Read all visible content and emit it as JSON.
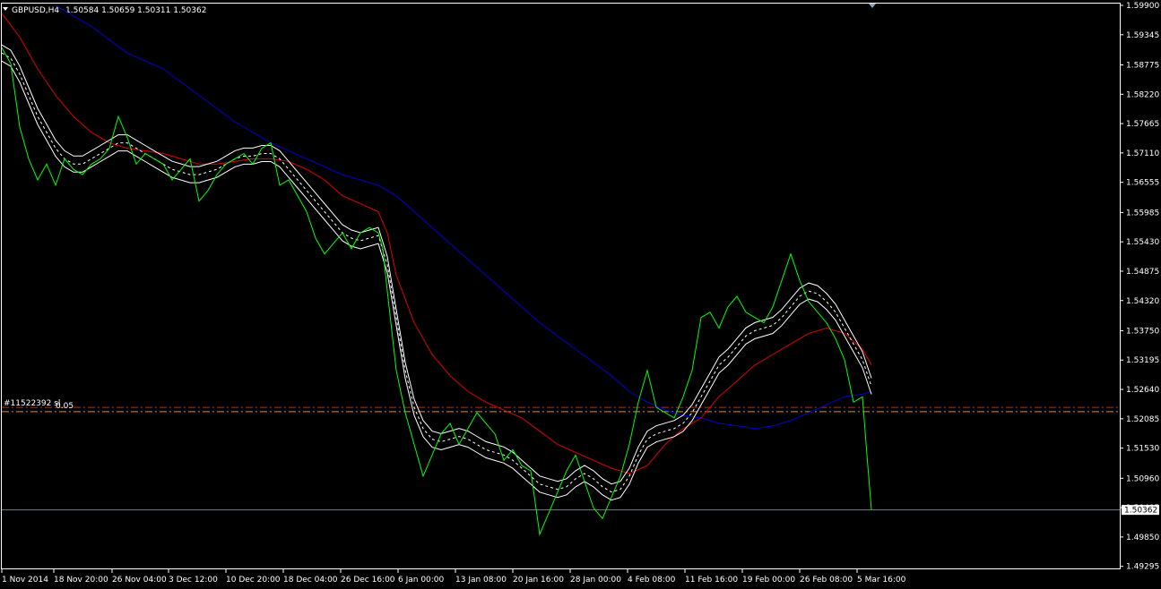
{
  "header": {
    "symbol": "GBPUSD,H4",
    "quote": "1.50584 1.50659 1.50311 1.50362"
  },
  "order": {
    "label": "#11522392 sl",
    "lots": "0.05"
  },
  "colors": {
    "background": "#000000",
    "price": "#00ff00",
    "ma_fast": "#e00000",
    "ma_slow": "#0000d0",
    "bands": "#ffffff",
    "current_price_line": "#6f7f9f"
  },
  "chart_data": {
    "type": "line",
    "ylim": [
      1.4929,
      1.599
    ],
    "y_ticks": [
      "1.59900",
      "1.59345",
      "1.58775",
      "1.58220",
      "1.57665",
      "1.57110",
      "1.56555",
      "1.55985",
      "1.55430",
      "1.54875",
      "1.54320",
      "1.53750",
      "1.53195",
      "1.52640",
      "1.52085",
      "1.51530",
      "1.50960",
      "1.50405",
      "1.49850",
      "1.49295"
    ],
    "x_ticks": [
      "1 Nov 2014",
      "18 Nov 20:00",
      "26 Nov 04:00",
      "3 Dec 12:00",
      "10 Dec 20:00",
      "18 Dec 04:00",
      "26 Dec 16:00",
      "6 Jan 00:00",
      "13 Jan 08:00",
      "20 Jan 16:00",
      "28 Jan 00:00",
      "4 Feb 08:00",
      "11 Feb 16:00",
      "19 Feb 00:00",
      "26 Feb 08:00",
      "5 Mar 16:00"
    ],
    "current_price": "1.50362",
    "order_level": 1.523,
    "sl_level": 1.5222,
    "series": [
      {
        "key": "price",
        "x": [
          0,
          10,
          20,
          30,
          40,
          50,
          60,
          70,
          80,
          90,
          100,
          110,
          120,
          130,
          140,
          150,
          160,
          170,
          180,
          190,
          200,
          210,
          220,
          230,
          240,
          250,
          260,
          270,
          280,
          290,
          300,
          310,
          320,
          330,
          340,
          350,
          360,
          370,
          380,
          390,
          400,
          410,
          420,
          425,
          430,
          440,
          450,
          460,
          470,
          480,
          490,
          500,
          510,
          520,
          530,
          540,
          550,
          560,
          570,
          580,
          590,
          600,
          610,
          620,
          630,
          640,
          650,
          660,
          670,
          680,
          690,
          700,
          710,
          720,
          730,
          740,
          750,
          760,
          770,
          780,
          790,
          800,
          810,
          820,
          830,
          840,
          850,
          860,
          870,
          880,
          890,
          900,
          910,
          920,
          930,
          940,
          950,
          960,
          965,
          970
        ],
        "y": [
          1.591,
          1.588,
          1.576,
          1.57,
          1.566,
          1.569,
          1.565,
          1.57,
          1.568,
          1.567,
          1.569,
          1.57,
          1.572,
          1.578,
          1.574,
          1.569,
          1.571,
          1.57,
          1.569,
          1.566,
          1.568,
          1.57,
          1.562,
          1.564,
          1.567,
          1.569,
          1.57,
          1.571,
          1.569,
          1.572,
          1.573,
          1.565,
          1.566,
          1.563,
          1.56,
          1.555,
          1.552,
          1.554,
          1.556,
          1.553,
          1.556,
          1.557,
          1.556,
          1.553,
          1.545,
          1.53,
          1.522,
          1.516,
          1.51,
          1.514,
          1.518,
          1.52,
          1.516,
          1.519,
          1.522,
          1.52,
          1.518,
          1.513,
          1.515,
          1.512,
          1.511,
          1.499,
          1.503,
          1.507,
          1.511,
          1.514,
          1.509,
          1.504,
          1.502,
          1.506,
          1.51,
          1.516,
          1.524,
          1.53,
          1.523,
          1.522,
          1.521,
          1.525,
          1.53,
          1.54,
          1.541,
          1.538,
          1.542,
          1.544,
          1.541,
          1.54,
          1.539,
          1.542,
          1.547,
          1.552,
          1.547,
          1.543,
          1.541,
          1.539,
          1.536,
          1.532,
          1.524,
          1.525,
          1.514,
          1.50362
        ]
      },
      {
        "key": "ma_fast",
        "x": [
          0,
          20,
          40,
          60,
          80,
          100,
          120,
          140,
          160,
          180,
          200,
          220,
          240,
          260,
          280,
          300,
          320,
          340,
          360,
          380,
          400,
          420,
          430,
          440,
          460,
          480,
          500,
          520,
          540,
          560,
          580,
          600,
          620,
          640,
          660,
          680,
          700,
          720,
          740,
          760,
          780,
          800,
          820,
          840,
          860,
          880,
          900,
          920,
          940,
          960,
          970
        ],
        "y": [
          1.5975,
          1.593,
          1.587,
          1.582,
          1.578,
          1.575,
          1.573,
          1.572,
          1.5715,
          1.571,
          1.57,
          1.569,
          1.569,
          1.5695,
          1.57,
          1.57,
          1.5695,
          1.568,
          1.566,
          1.563,
          1.5615,
          1.56,
          1.556,
          1.548,
          1.539,
          1.533,
          1.529,
          1.526,
          1.524,
          1.5225,
          1.521,
          1.5185,
          1.516,
          1.5145,
          1.513,
          1.5115,
          1.5105,
          1.512,
          1.516,
          1.519,
          1.521,
          1.525,
          1.528,
          1.531,
          1.533,
          1.535,
          1.537,
          1.538,
          1.537,
          1.534,
          1.531
        ]
      },
      {
        "key": "ma_slow",
        "x": [
          60,
          100,
          140,
          180,
          220,
          260,
          300,
          340,
          380,
          420,
          440,
          480,
          520,
          560,
          600,
          640,
          680,
          700,
          720,
          740,
          760,
          780,
          800,
          820,
          840,
          860,
          880,
          900,
          920,
          940,
          960,
          970
        ],
        "y": [
          1.599,
          1.595,
          1.59,
          1.587,
          1.582,
          1.577,
          1.573,
          1.57,
          1.567,
          1.565,
          1.563,
          1.557,
          1.551,
          1.545,
          1.539,
          1.534,
          1.529,
          1.526,
          1.524,
          1.5225,
          1.5215,
          1.521,
          1.52,
          1.5195,
          1.519,
          1.5195,
          1.5205,
          1.522,
          1.5235,
          1.525,
          1.5255,
          1.526
        ]
      },
      {
        "key": "bands",
        "x": [
          0,
          10,
          20,
          30,
          40,
          50,
          60,
          70,
          80,
          90,
          100,
          110,
          120,
          130,
          140,
          150,
          160,
          170,
          180,
          190,
          200,
          210,
          220,
          230,
          240,
          250,
          260,
          270,
          280,
          290,
          300,
          310,
          320,
          330,
          340,
          350,
          360,
          370,
          380,
          390,
          400,
          410,
          420,
          430,
          440,
          450,
          460,
          470,
          480,
          490,
          500,
          510,
          520,
          530,
          540,
          550,
          560,
          570,
          580,
          590,
          600,
          610,
          620,
          630,
          640,
          650,
          660,
          670,
          680,
          690,
          700,
          710,
          720,
          730,
          740,
          750,
          760,
          770,
          780,
          790,
          800,
          810,
          820,
          830,
          840,
          850,
          860,
          870,
          880,
          890,
          900,
          910,
          920,
          930,
          940,
          950,
          960,
          970
        ],
        "y": [
          1.59,
          1.589,
          1.586,
          1.582,
          1.578,
          1.575,
          1.572,
          1.57,
          1.569,
          1.569,
          1.57,
          1.571,
          1.572,
          1.573,
          1.573,
          1.572,
          1.571,
          1.57,
          1.569,
          1.568,
          1.5675,
          1.567,
          1.567,
          1.5675,
          1.568,
          1.569,
          1.57,
          1.5705,
          1.5705,
          1.571,
          1.571,
          1.57,
          1.568,
          1.566,
          1.564,
          1.562,
          1.56,
          1.558,
          1.556,
          1.555,
          1.5545,
          1.555,
          1.5555,
          1.55,
          1.54,
          1.53,
          1.523,
          1.519,
          1.517,
          1.5165,
          1.517,
          1.5175,
          1.517,
          1.516,
          1.515,
          1.5145,
          1.514,
          1.513,
          1.5115,
          1.51,
          1.5085,
          1.508,
          1.5075,
          1.508,
          1.5095,
          1.5105,
          1.5095,
          1.508,
          1.507,
          1.5075,
          1.51,
          1.514,
          1.517,
          1.518,
          1.5185,
          1.519,
          1.52,
          1.522,
          1.525,
          1.528,
          1.531,
          1.5325,
          1.5345,
          1.5365,
          1.5375,
          1.538,
          1.5385,
          1.54,
          1.542,
          1.544,
          1.545,
          1.5445,
          1.543,
          1.541,
          1.538,
          1.535,
          1.532,
          1.527
        ]
      }
    ]
  }
}
